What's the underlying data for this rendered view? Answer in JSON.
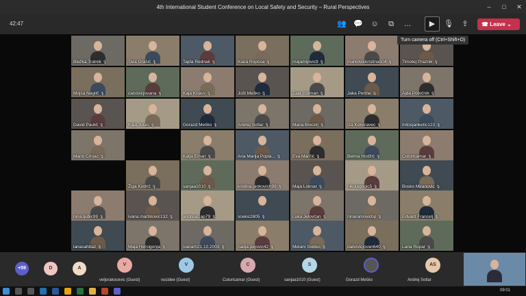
{
  "window": {
    "title": "4th International Student Conference on Local Safety and Security – Rural Perspectives"
  },
  "toolbar": {
    "timer": "42:47",
    "leave_label": "Leave",
    "tooltip": "Turn camera off (Ctrl+Shift+O)"
  },
  "participants": [
    [
      "Blažka Tratnik",
      "Tara Grašič",
      "Tajda Rednak",
      "Kiara Roposa",
      "majamijovic9",
      "markovickristina504",
      "Timotej Praznik"
    ],
    [
      "Mojca Nagilč",
      "canovicjovana",
      "Kaja Knavs",
      "Jošt Meško",
      "Zala Gutman",
      "Jaka Perme",
      "Ajda Potočnik"
    ],
    [
      "David Paulič",
      "Kaja Juras",
      "Gorazd Meško",
      "Andrej Sotlar",
      "Maria Brecelj",
      "Iza Kokoravec",
      "milosjanketic123"
    ],
    [
      "Mario Crnjac",
      "Katja Eman",
      "Ana Marija Popla...",
      "Eva Marčić",
      "Belma Hodžić",
      "Cuturicamar"
    ],
    [
      "Žiga Kodrič",
      "sanjaa1010",
      "kristina.jankovich99",
      "Maja Loknar",
      "nikolagogic5",
      "Bosko Miranovic"
    ],
    [
      "nina.ljubic99",
      "ivana.martinovic132",
      "andreap.ap79",
      "scekic2805",
      "Luka Jelovčan",
      "ninaramovicbp",
      "Edvard Francelj"
    ],
    [
      "lanasahbaz",
      "Maja Hercigonja",
      "ivanam21.10.2003",
      "nadja.pejovic42",
      "Melani Svetec",
      "dabovicjovan640",
      "Lana Rupar"
    ]
  ],
  "strip": {
    "overflow": "+59",
    "avatars": [
      "D",
      "A"
    ],
    "people": [
      {
        "initial": "V",
        "label": "veljorakocevic (Guest)",
        "color": "#e8a9a2"
      },
      {
        "initial": "V",
        "label": "vucidee (Guest)",
        "color": "#9fc8e8"
      },
      {
        "initial": "C",
        "label": "Cuturicamar (Guest)",
        "color": "#d7a8b0"
      },
      {
        "initial": "S",
        "label": "sanjaa1010 (Guest)",
        "color": "#b2d7e8"
      },
      {
        "initial": "",
        "label": "Gorazd Meško",
        "color": "#555"
      },
      {
        "initial": "AS",
        "label": "Andrej Sotlar",
        "color": "#e6c8a8"
      }
    ]
  },
  "taskbar": {
    "time": "09:01"
  },
  "colors": {
    "accent": "#5b5fc7",
    "leave": "#c4314b"
  }
}
